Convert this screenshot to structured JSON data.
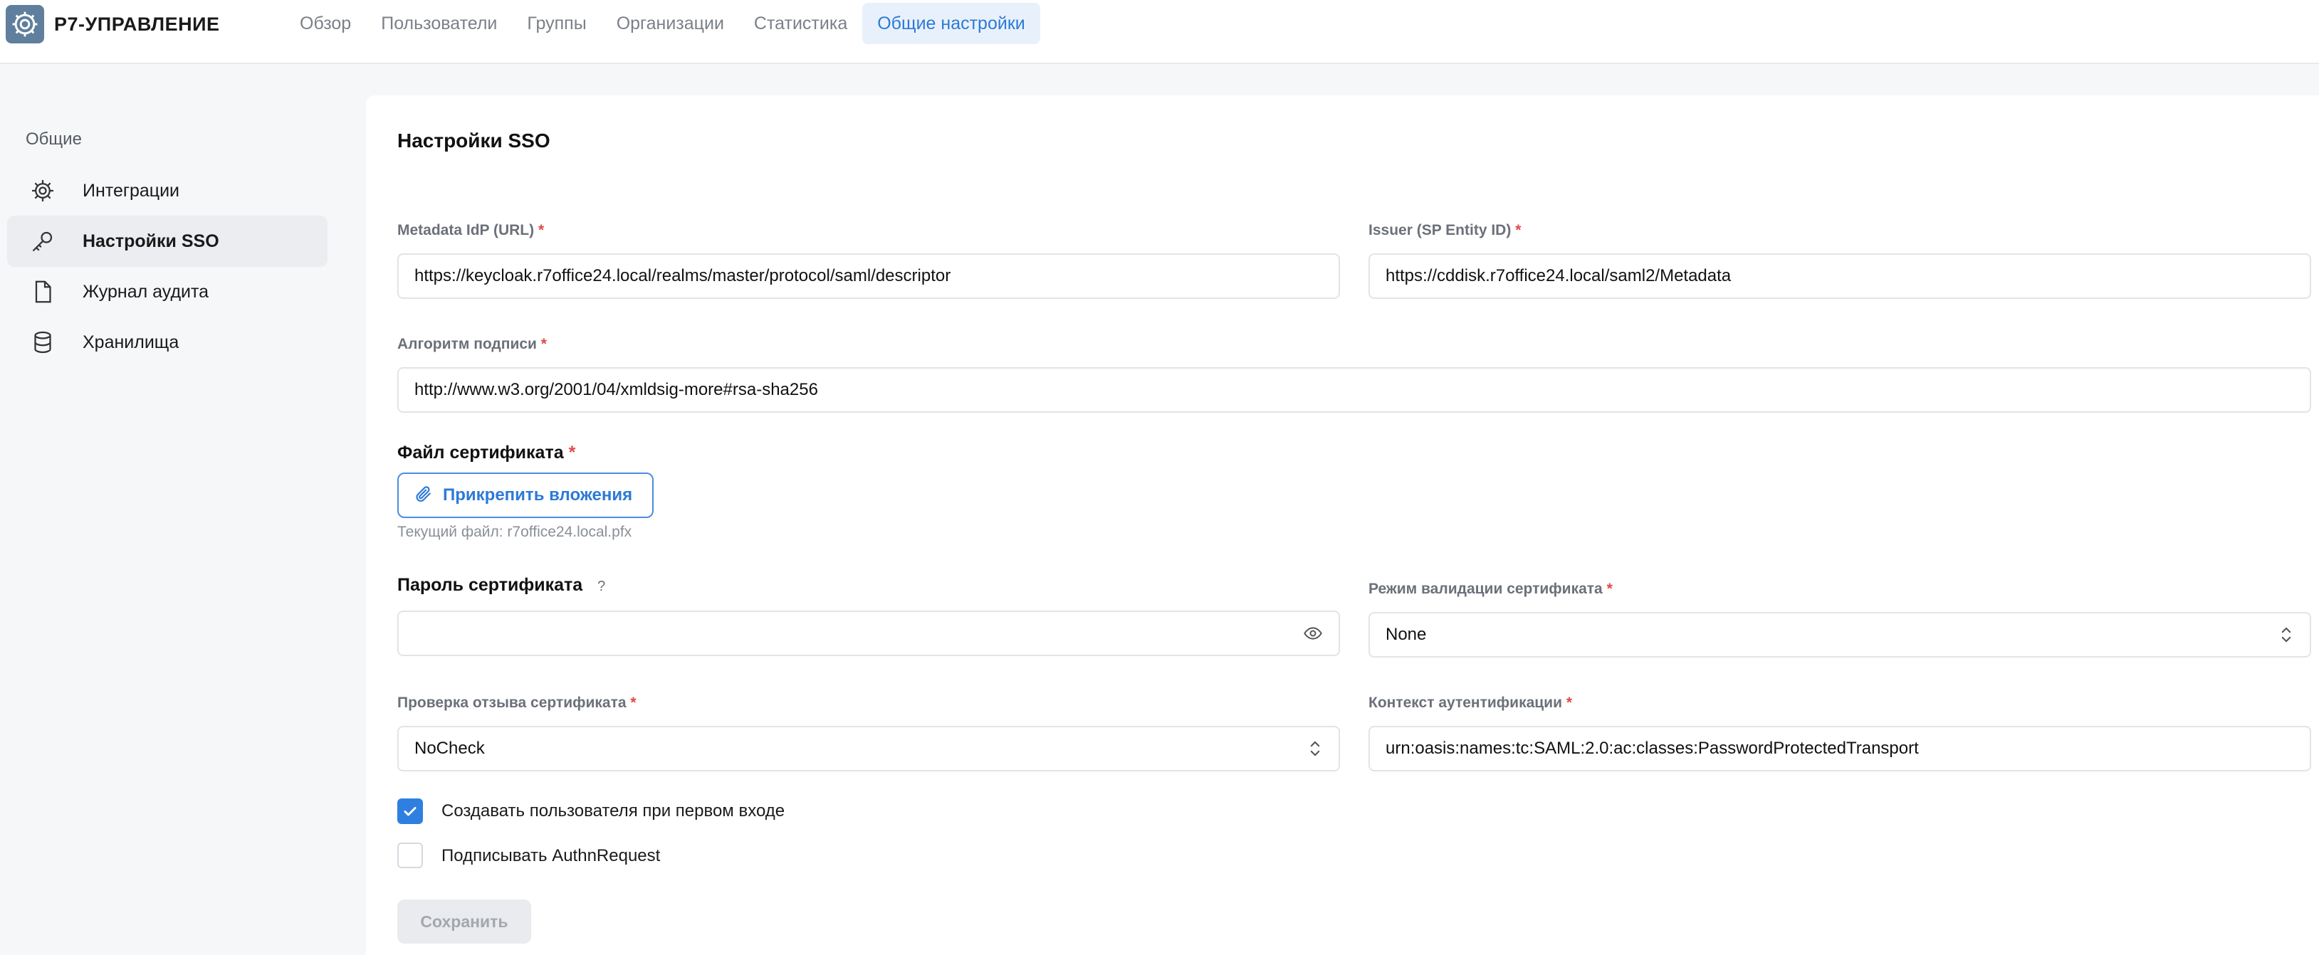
{
  "app": {
    "name": "Р7-УПРАВЛЕНИЕ"
  },
  "nav": {
    "items": [
      {
        "label": "Обзор"
      },
      {
        "label": "Пользователи"
      },
      {
        "label": "Группы"
      },
      {
        "label": "Организации"
      },
      {
        "label": "Статистика"
      },
      {
        "label": "Общие настройки"
      }
    ],
    "active": "Общие настройки"
  },
  "sidebar": {
    "section_title": "Общие",
    "items": [
      {
        "label": "Интеграции",
        "icon": "gear-icon"
      },
      {
        "label": "Настройки SSO",
        "icon": "key-icon"
      },
      {
        "label": "Журнал аудита",
        "icon": "document-icon"
      },
      {
        "label": "Хранилища",
        "icon": "database-icon"
      }
    ],
    "active": "Настройки SSO"
  },
  "form": {
    "title": "Настройки SSO",
    "required_mark": "*",
    "metadata_idp": {
      "label": "Metadata IdP (URL)",
      "value": "https://keycloak.r7office24.local/realms/master/protocol/saml/descriptor"
    },
    "issuer": {
      "label": "Issuer (SP Entity ID)",
      "value": "https://cddisk.r7office24.local/saml2/Metadata"
    },
    "signature_algorithm": {
      "label": "Алгоритм подписи",
      "value": "http://www.w3.org/2001/04/xmldsig-more#rsa-sha256"
    },
    "certificate_file": {
      "label": "Файл сертификата",
      "attach_label": "Прикрепить вложения",
      "current_file": "Текущий файл: r7office24.local.pfx"
    },
    "certificate_password": {
      "label": "Пароль сертификата",
      "help": "?",
      "value": ""
    },
    "validation_mode": {
      "label": "Режим валидации сертификата",
      "value": "None"
    },
    "revocation_check": {
      "label": "Проверка отзыва сертификата",
      "value": "NoCheck"
    },
    "auth_context": {
      "label": "Контекст аутентификации",
      "value": "urn:oasis:names:tc:SAML:2.0:ac:classes:PasswordProtectedTransport"
    },
    "create_user_on_first_login": {
      "label": "Создавать пользователя при первом входе",
      "checked": true
    },
    "sign_authn_request": {
      "label": "Подписывать AuthnRequest",
      "checked": false
    },
    "save_label": "Сохранить",
    "save_disabled": true
  },
  "colors": {
    "accent": "#2d7ad6",
    "required": "#e04a4a",
    "active_nav_bg": "#e8f1fb",
    "checkbox_on": "#2f7fe0"
  }
}
